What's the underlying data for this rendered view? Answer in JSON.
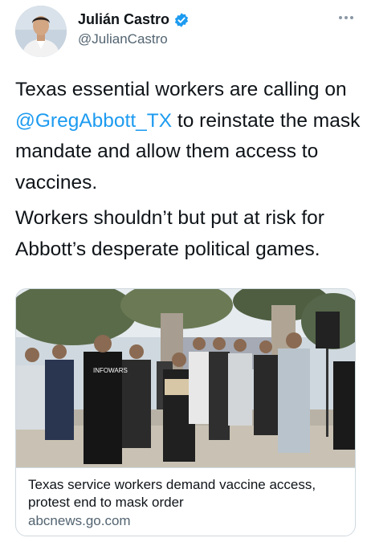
{
  "author": {
    "display_name": "Julián Castro",
    "handle": "@JulianCastro",
    "verified": true,
    "avatar_icon": "profile-photo"
  },
  "tweet": {
    "p1_before": "Texas essential workers are calling on ",
    "mention": "@GregAbbott_TX",
    "p1_after": " to reinstate the mask mandate and allow them access to vaccines.",
    "p2": "Workers shouldn’t but put at risk for Abbott’s desperate political games."
  },
  "link_card": {
    "image_icon": "protest-photo",
    "sign_text": "INFOWARS",
    "title": "Texas service workers demand vaccine access, protest end to mask order",
    "domain": "abcnews.go.com"
  },
  "colors": {
    "accent": "#1d9bf0",
    "text": "#0f1419",
    "secondary": "#536471",
    "border": "#cfd9de"
  }
}
